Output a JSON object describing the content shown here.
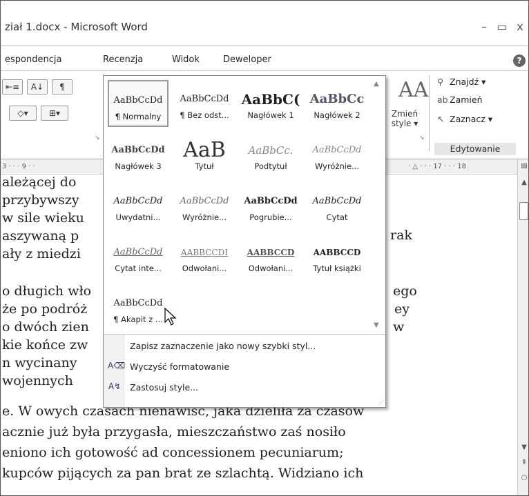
{
  "window": {
    "title": "ział 1.docx - Microsoft Word",
    "min": "–",
    "max": "▭",
    "close": "x"
  },
  "tabs": [
    "espondencja",
    "Recenzja",
    "Widok",
    "Deweloper"
  ],
  "help_label": "?",
  "ribbon": {
    "change_styles_label": "Zmień style ▾",
    "change_styles_glyph": "AA",
    "editing": {
      "find": "Znajdź ▾",
      "replace": "Zamień",
      "select": "Zaznacz ▾",
      "group_title": "Edytowanie"
    },
    "para_buttons": [
      "⇤≡",
      "A↓",
      "¶",
      "◇▾",
      "⊞▾"
    ]
  },
  "ruler_marks": [
    "3 · · · 9 · ·",
    "· △ · · · 17 · · · 18"
  ],
  "gallery": {
    "styles": [
      {
        "preview": "AaBbCcDd",
        "label": "¶ Normalny",
        "selected": true
      },
      {
        "preview": "AaBbCcDd",
        "label": "¶ Bez odst..."
      },
      {
        "preview": "AaBbC(",
        "label": "Nagłówek 1"
      },
      {
        "preview": "AaBbCc",
        "label": "Nagłówek 2"
      },
      {
        "preview": "AaBbCcDd",
        "label": "Nagłówek 3"
      },
      {
        "preview": "AaB",
        "label": "Tytuł"
      },
      {
        "preview": "AaBbCc.",
        "label": "Podtytuł"
      },
      {
        "preview": "AaBbCcDd",
        "label": "Wyróżnie..."
      },
      {
        "preview": "AaBbCcDd",
        "label": "Uwydatni..."
      },
      {
        "preview": "AaBbCcDd",
        "label": "Wyróżnie..."
      },
      {
        "preview": "AaBbCcDd",
        "label": "Pogrubie..."
      },
      {
        "preview": "AaBbCcDd",
        "label": "Cytat"
      },
      {
        "preview": "AaBbCcDd",
        "label": "Cytat inte..."
      },
      {
        "preview": "AABBCCDI",
        "label": "Odwołani..."
      },
      {
        "preview": "AABBCCD",
        "label": "Odwołani..."
      },
      {
        "preview": "AABBCCD",
        "label": "Tytuł książki"
      },
      {
        "preview": "AaBbCcDd",
        "label": "¶ Akapit z ..."
      }
    ],
    "menu": [
      {
        "icon": "",
        "text": "Zapisz zaznaczenie jako nowy szybki styl..."
      },
      {
        "icon": "A⌫",
        "text": "Wyczyść formatowanie"
      },
      {
        "icon": "A↯",
        "text": "Zastosuj style..."
      }
    ]
  },
  "document_lines": [
    "ależącej do",
    "przybywszy",
    "w sile wieku",
    "aszywaną p",
    "ały z miedzi",
    "o długich wło",
    "że po podróż",
    "o dwóch zien",
    "kie końce zw",
    "n wycinany",
    " wojennych",
    "e. W owych czasach nienawiść, jaka dzieliła za czasów",
    "acznie już była przygasła, mieszczaństwo zaś nosiło",
    "eniono ich gotowość ad concessionem pecuniarum;",
    "kupców pijących za pan brat ze szlachtą. Widziano ich"
  ],
  "document_right_fragments": [
    "rak",
    "ego",
    "ey",
    "w"
  ]
}
